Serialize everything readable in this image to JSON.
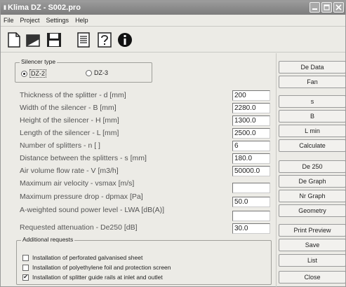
{
  "window": {
    "title": "Klima DZ - S002.pro",
    "app_icon": "II",
    "controls": [
      "minimize-icon",
      "maximize-icon",
      "close-icon"
    ]
  },
  "menu": [
    "File",
    "Project",
    "Settings",
    "Help"
  ],
  "toolbar": [
    "new-file-icon",
    "open-folder-icon",
    "save-disk-icon",
    "document-icon",
    "help-question-icon",
    "info-icon"
  ],
  "silencer_type": {
    "legend": "Silencer type",
    "options": [
      {
        "label": "DZ-2",
        "selected": true
      },
      {
        "label": "DZ-3",
        "selected": false
      }
    ]
  },
  "params": [
    {
      "label": "Thickness of the splitter - d [mm]",
      "value": "200"
    },
    {
      "label": "Width of the silencer - B [mm]",
      "value": "2280.0"
    },
    {
      "label": "Height of the silencer - H [mm]",
      "value": "1300.0"
    },
    {
      "label": "Length of the silencer - L [mm]",
      "value": "2500.0"
    },
    {
      "label": "Number of splitters - n [ ]",
      "value": "6"
    },
    {
      "label": "Distance between the splitters - s [mm]",
      "value": "180.0"
    },
    {
      "label": "Air volume flow rate - V [m3/h]",
      "value": "50000.0"
    },
    {
      "label": "Maximum air velocity - vsmax [m/s]",
      "value": ""
    },
    {
      "label": "Maximum pressure drop - dpmax [Pa]",
      "value": "50.0"
    },
    {
      "label": "A-weighted sound power level - LWA [dB(A)]",
      "value": ""
    },
    {
      "label": "Requested attenuation - De250 [dB]",
      "value": "30.0"
    }
  ],
  "additional": {
    "legend": "Additional requests",
    "items": [
      {
        "label": "Installation of perforated galvanised sheet",
        "checked": false
      },
      {
        "label": "Installation of polyethylene foil and protection screen",
        "checked": false
      },
      {
        "label": "Installation of splitter guide rails at inlet and outlet",
        "checked": true
      }
    ]
  },
  "buttons": [
    "De Data",
    "Fan",
    "s",
    "B",
    "L min",
    "Calculate",
    "De 250",
    "De Graph",
    "Nr Graph",
    "Geometry",
    "Print Preview",
    "Save",
    "List",
    "Close"
  ],
  "check_mark": "✔"
}
